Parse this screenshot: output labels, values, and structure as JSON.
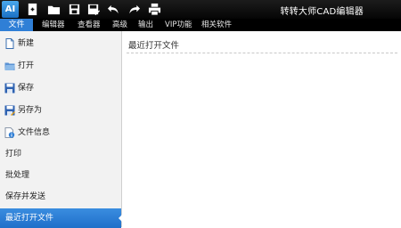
{
  "app": {
    "logo": "AI",
    "title": "转转大师CAD编辑器"
  },
  "toolbar": [
    {
      "icon": "new-icon"
    },
    {
      "icon": "open-folder-icon"
    },
    {
      "icon": "save-icon"
    },
    {
      "icon": "save-as-icon"
    },
    {
      "icon": "undo-icon"
    },
    {
      "icon": "redo-icon"
    },
    {
      "icon": "print-icon"
    }
  ],
  "menubar": {
    "file": "文件",
    "items": [
      "编辑器",
      "查看器",
      "高级",
      "输出",
      "VIP功能",
      "相关软件"
    ]
  },
  "sidebar": {
    "items": [
      {
        "label": "新建",
        "icon": "new-icon"
      },
      {
        "label": "打开",
        "icon": "open-folder-icon"
      },
      {
        "label": "保存",
        "icon": "save-icon"
      },
      {
        "label": "另存为",
        "icon": "save-as-icon"
      },
      {
        "label": "文件信息",
        "icon": "file-info-icon"
      },
      {
        "label": "打印"
      },
      {
        "label": "批处理"
      },
      {
        "label": "保存并发送"
      },
      {
        "label": "最近打开文件",
        "active": true
      }
    ]
  },
  "content": {
    "title": "最近打开文件"
  },
  "colors": {
    "accent": "#2f7fd6",
    "titlebar": "#0d0d0d",
    "sidebar_bg": "#f2f2f2"
  }
}
